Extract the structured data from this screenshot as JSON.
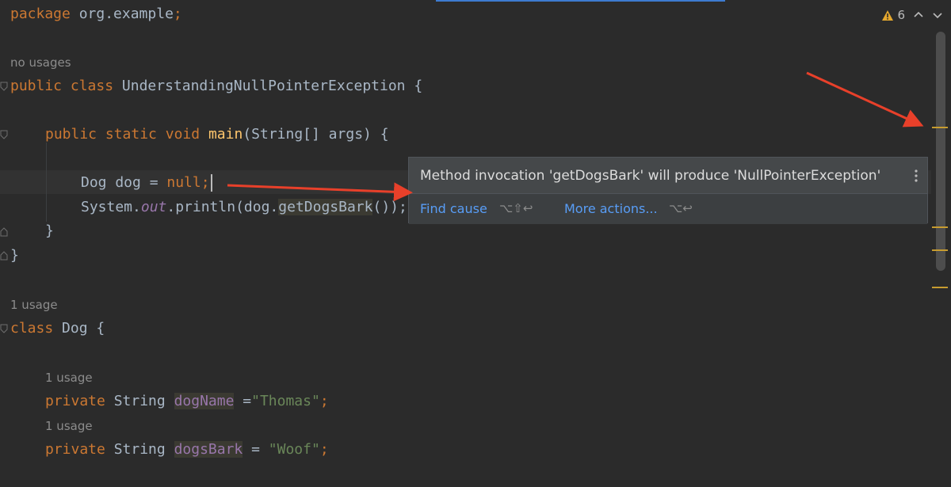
{
  "editor": {
    "package_line": {
      "keyword": "package",
      "name": " org.example",
      "semi": ";"
    },
    "hints": {
      "no_usages": "no usages",
      "class_usage": "1 usage",
      "dogname_usage": "1 usage",
      "dogsbark_usage": "1 usage",
      "dogname_usage_top": "1 usage"
    },
    "class_decl": {
      "kw1": "public",
      "kw2": "class",
      "name": " UnderstandingNullPointerException {"
    },
    "main_decl": {
      "kw1": "public",
      "kw2": "static",
      "kw3": "void",
      "name": "main",
      "params": "(String[] args) {"
    },
    "dog_line": {
      "type": "Dog dog = ",
      "null": "null",
      "semi": ";"
    },
    "println_line": {
      "prefix": "System.",
      "out": "out",
      "mid": ".println(dog.",
      "method": "getDogsBark",
      "suffix": "());"
    },
    "close_method": "}",
    "close_class": "}",
    "dog_class": {
      "kw": "class",
      "name": " Dog {"
    },
    "field1": {
      "kw": "private",
      "type": " String ",
      "name": "dogName",
      "eq": " =",
      "value": "\"Thomas\"",
      "semi": ";"
    },
    "field2": {
      "kw": "private",
      "type": " String ",
      "name": "dogsBark",
      "eq": " = ",
      "value": "\"Woof\"",
      "semi": ";"
    }
  },
  "warnings": {
    "count": "6",
    "icon": "warning-triangle-icon"
  },
  "popup": {
    "message": "Method invocation 'getDogsBark' will produce 'NullPointerException'",
    "find_cause": "Find cause",
    "find_cause_shortcut": "⌥⇧↩",
    "more_actions": "More actions...",
    "more_actions_shortcut": "⌥↩"
  },
  "colors": {
    "background": "#2b2b2b",
    "keyword": "#cc7832",
    "function": "#ffc66d",
    "string": "#6a8759",
    "field": "#9876aa",
    "link": "#589df6",
    "annotation_arrow": "#e8402a",
    "warning": "#e5a82e"
  }
}
